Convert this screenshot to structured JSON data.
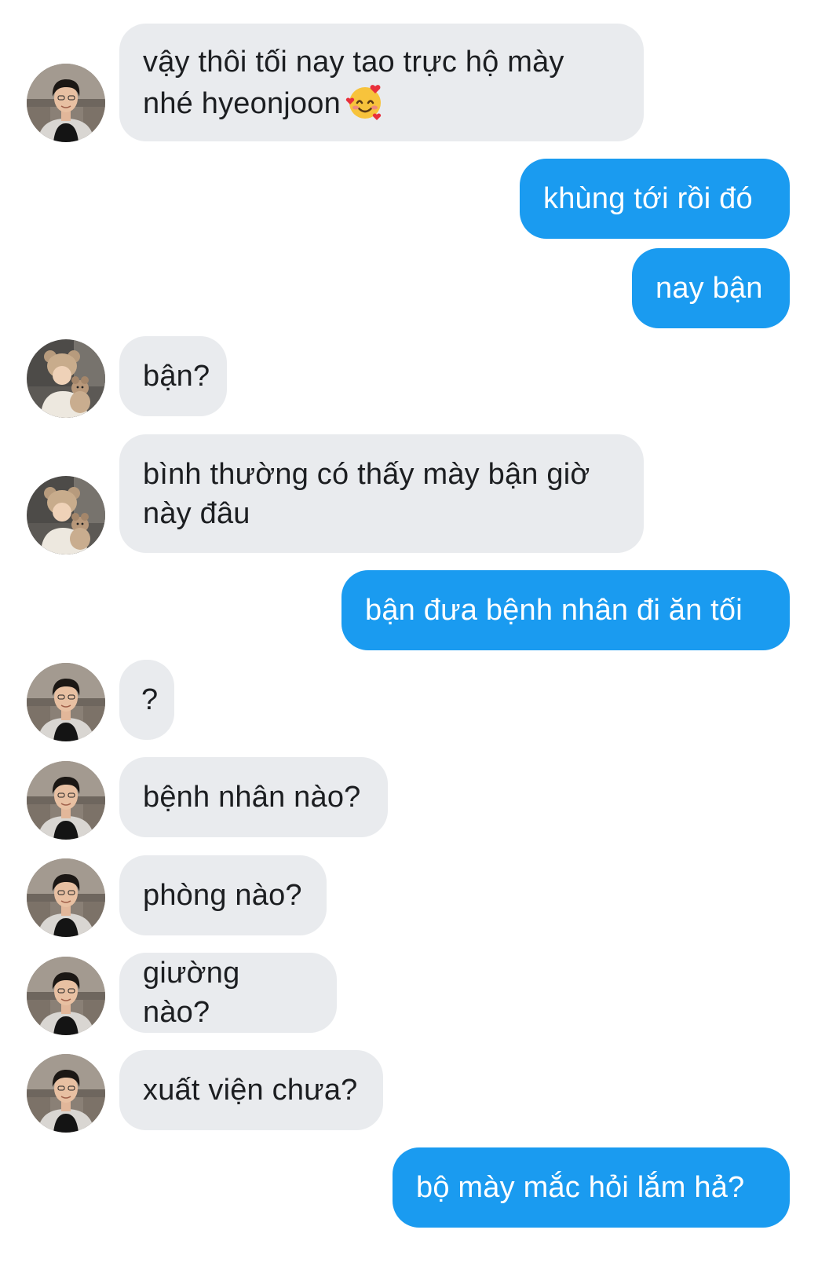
{
  "messages": [
    {
      "sender": "them",
      "avatar": "boy-photo",
      "text": "vậy thôi tối nay tao trực hộ mày",
      "text2": "nhé hyeonjoon",
      "emoji": "smiling-face-with-hearts"
    },
    {
      "sender": "me",
      "text": "khùng tới rồi đó"
    },
    {
      "sender": "me",
      "text": "nay bận"
    },
    {
      "sender": "them",
      "avatar": "bear-hat-photo",
      "text": "bận?"
    },
    {
      "sender": "them",
      "avatar": "bear-hat-photo",
      "text": "bình thường có thấy mày bận giờ",
      "text2": "này đâu"
    },
    {
      "sender": "me",
      "text": "bận đưa bệnh nhân đi ăn tối"
    },
    {
      "sender": "them",
      "avatar": "boy-photo",
      "text": "?"
    },
    {
      "sender": "them",
      "avatar": "boy-photo",
      "text": "bệnh nhân nào?"
    },
    {
      "sender": "them",
      "avatar": "boy-photo",
      "text": "phòng nào?"
    },
    {
      "sender": "them",
      "avatar": "boy-photo",
      "text": "giường nào?"
    },
    {
      "sender": "them",
      "avatar": "boy-photo",
      "text": "xuất viện chưa?"
    },
    {
      "sender": "me",
      "text": "bộ mày mắc hỏi lắm hả?"
    }
  ],
  "colors": {
    "incoming_bubble": "#e9ebee",
    "incoming_text": "#1c1e21",
    "outgoing_bubble": "#1a9bf0",
    "outgoing_text": "#ffffff",
    "background": "#ffffff"
  }
}
